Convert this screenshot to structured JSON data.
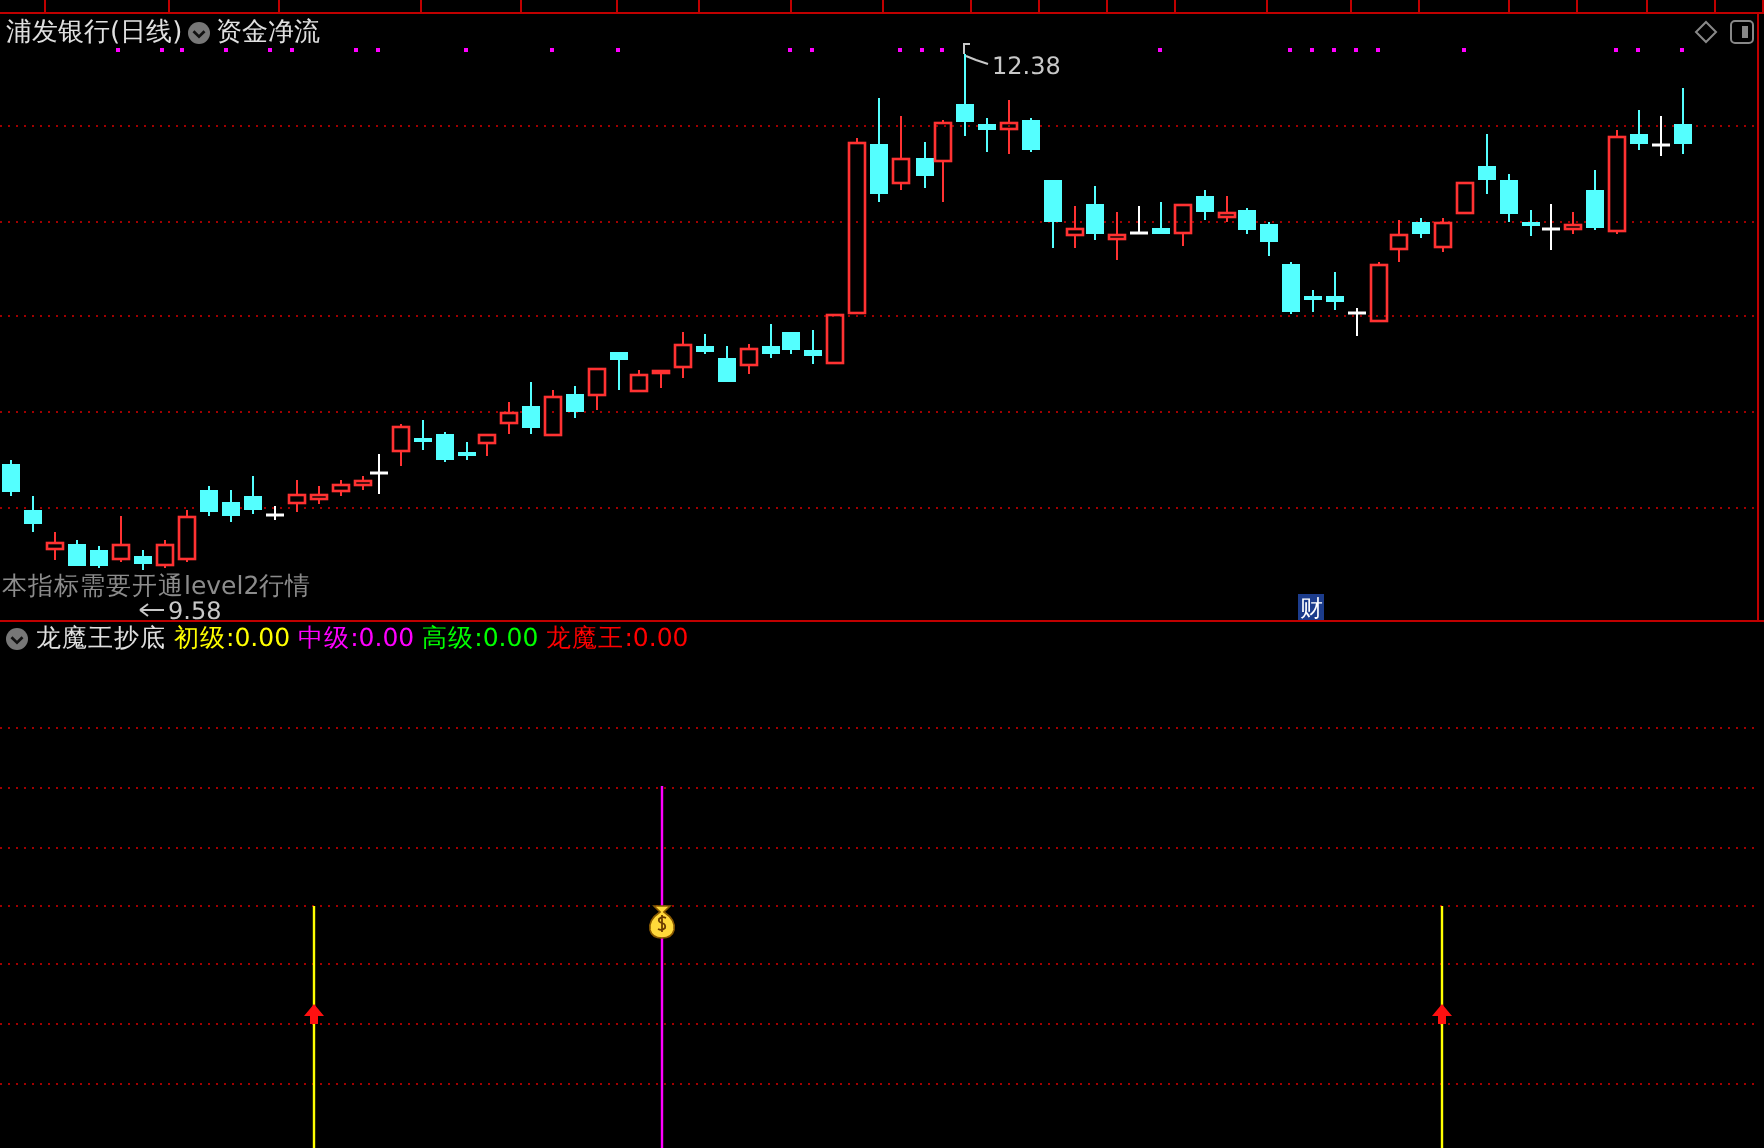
{
  "chart": {
    "title": "浦发银行(日线)",
    "indicator": "资金净流",
    "high_label": "12.38",
    "low_label": "9.58",
    "notice": "本指标需要开通level2行情",
    "event_badge": "财"
  },
  "indicator_panel": {
    "title": "龙魔王抄底",
    "legend": [
      {
        "label": "初级:",
        "value": "0.00",
        "color": "#ffff00"
      },
      {
        "label": "中级:",
        "value": "0.00",
        "color": "#ff00ff"
      },
      {
        "label": "高级:",
        "value": "0.00",
        "color": "#00ff00"
      },
      {
        "label": "龙魔王:",
        "value": "0.00",
        "color": "#ff0000"
      }
    ]
  }
}
